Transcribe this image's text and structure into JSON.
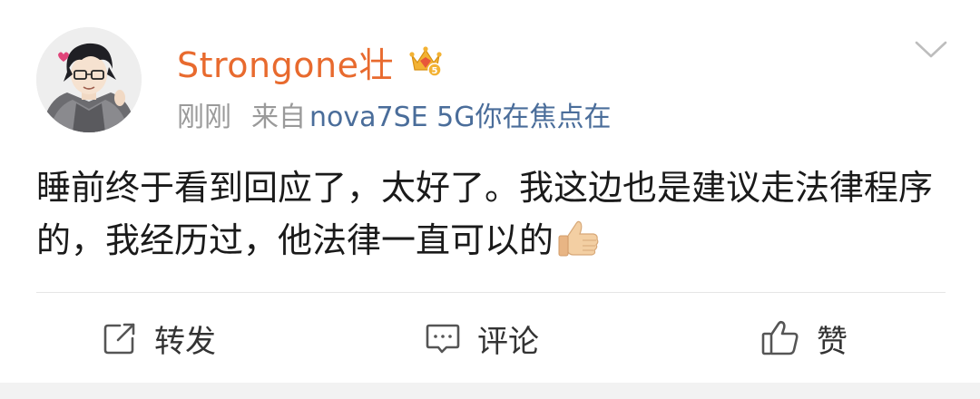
{
  "post": {
    "author": {
      "name": "Strongone壮",
      "badge_icon": "vip-crown-badge-icon"
    },
    "meta": {
      "time": "刚刚",
      "from_prefix": "来自",
      "device": "nova7SE 5G你在焦点在"
    },
    "text": "睡前终于看到回应了，太好了。我这边也是建议走法律程序的，我经历过，他法律一直可以的",
    "text_emoji": "thumbs-up-icon"
  },
  "actions": {
    "repost_label": "转发",
    "comment_label": "评论",
    "like_label": "赞"
  },
  "colors": {
    "username": "#e86a2e",
    "device_link": "#4a6d9a",
    "meta_gray": "#9a9a9a",
    "body_text": "#1a1a1a",
    "divider": "#e6e6e6"
  }
}
